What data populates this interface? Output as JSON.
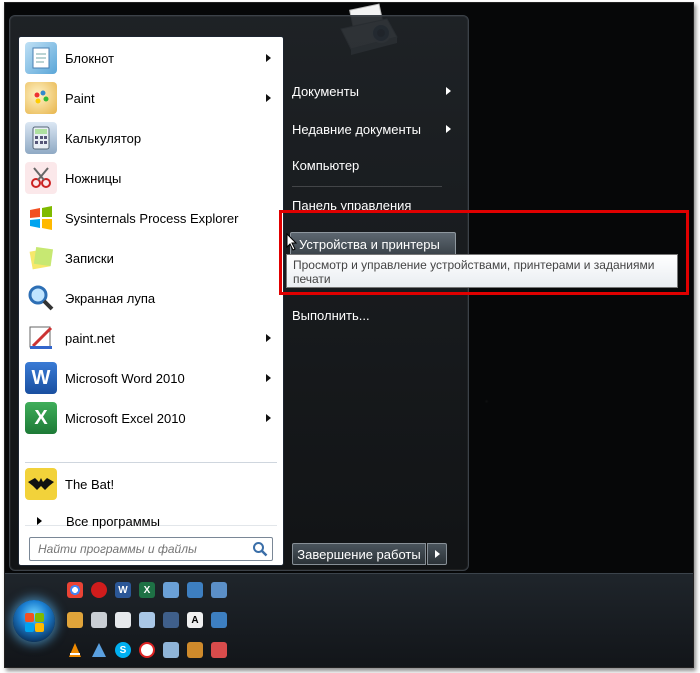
{
  "left_pane": {
    "programs": [
      {
        "label": "Блокнот",
        "has_arrow": true,
        "icon": "notepad-icon"
      },
      {
        "label": "Paint",
        "has_arrow": true,
        "icon": "paint-icon"
      },
      {
        "label": "Калькулятор",
        "has_arrow": false,
        "icon": "calculator-icon"
      },
      {
        "label": "Ножницы",
        "has_arrow": false,
        "icon": "scissors-icon"
      },
      {
        "label": "Sysinternals Process Explorer",
        "has_arrow": false,
        "icon": "process-explorer-icon"
      },
      {
        "label": "Записки",
        "has_arrow": false,
        "icon": "sticky-notes-icon"
      },
      {
        "label": "Экранная лупа",
        "has_arrow": false,
        "icon": "magnifier-icon"
      },
      {
        "label": "paint.net",
        "has_arrow": true,
        "icon": "paintnet-icon"
      },
      {
        "label": "Microsoft Word 2010",
        "has_arrow": true,
        "icon": "word-icon"
      },
      {
        "label": "Microsoft Excel 2010",
        "has_arrow": true,
        "icon": "excel-icon"
      }
    ],
    "pinned": {
      "label": "The Bat!",
      "icon": "the-bat-icon"
    },
    "all_programs_label": "Все программы",
    "search_placeholder": "Найти программы и файлы"
  },
  "right_pane": {
    "items": [
      {
        "label": "Документы",
        "has_arrow": true
      },
      {
        "label": "Недавние документы",
        "has_arrow": true
      },
      {
        "label": "Компьютер",
        "has_arrow": false
      },
      {
        "label": "Панель управления",
        "has_arrow": false
      }
    ],
    "highlighted_item": "Устройства и принтеры",
    "tooltip": "Просмотр и управление устройствами, принтерами и заданиями печати",
    "run_label": "Выполнить...",
    "shutdown_label": "Завершение работы"
  },
  "taskbar": {
    "icons_row1": [
      "chrome-icon",
      "opera-icon",
      "word-icon",
      "excel-icon",
      "network-icon",
      "monitor-icon",
      "display-icon"
    ],
    "icons_row2": [
      "paint-icon",
      "tool-icon",
      "document-icon",
      "notes-icon",
      "save-icon",
      "font-icon",
      "list-icon"
    ],
    "icons_row3": [
      "vlc-icon",
      "process-icon",
      "skype-icon",
      "restricted-icon",
      "gallery-icon",
      "paint-brush-icon",
      "game-icon"
    ]
  },
  "colors": {
    "highlight_border": "#e00000",
    "menu_bg": "#1c2024",
    "left_pane_bg": "#ffffff"
  }
}
